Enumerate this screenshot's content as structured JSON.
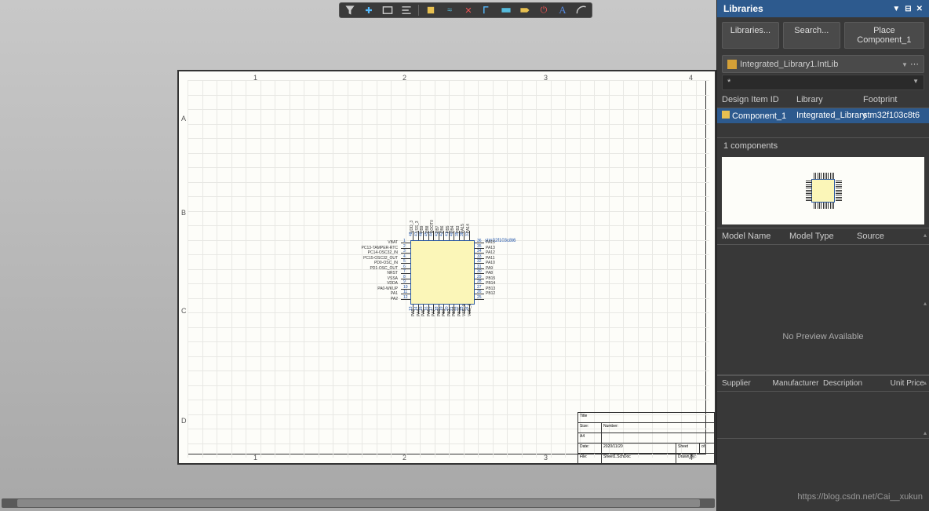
{
  "toolbar": {
    "items": [
      "filter",
      "place-wire",
      "place-rect",
      "align",
      "comp",
      "net",
      "cross",
      "bus",
      "dim",
      "tag",
      "power",
      "text",
      "arc"
    ]
  },
  "sheet": {
    "cols": [
      "1",
      "2",
      "3",
      "4"
    ],
    "rows": [
      "A",
      "B",
      "C",
      "D"
    ],
    "title_block": {
      "title_lbl": "Title",
      "size_lbl": "Size:",
      "size_val": "A4",
      "number_lbl": "Number:",
      "date_lbl": "Date:",
      "date_val": "2020/11/20",
      "file_lbl": "File:",
      "file_val": "Sheet1.SchDoc",
      "sheet_lbl": "Sheet",
      "of_lbl": "of",
      "drawn_lbl": "Drawn By:"
    }
  },
  "component": {
    "designator": "stm32f103c8t6",
    "left_pins": [
      "VBAT",
      "PC13-TAMPER-RTC",
      "PC14-OSC32_IN",
      "PC15-OSC32_OUT",
      "PD0-OSC_IN",
      "PD1-OSC_OUT",
      "NRST",
      "VSSA",
      "VDDA",
      "PA0-WKUP",
      "PA1",
      "PA2"
    ],
    "left_nums": [
      "1",
      "2",
      "3",
      "4",
      "5",
      "6",
      "7",
      "8",
      "9",
      "10",
      "11",
      "12"
    ],
    "right_pins": [
      "VDD_3",
      "VSS_3",
      "PB9",
      "PB8",
      "BOOT0",
      "PB7",
      "PB6",
      "PB5",
      "PB4",
      "PB3",
      "PA15",
      "PA14",
      "PA13",
      "PA12",
      "PA11",
      "PA10",
      "PA9",
      "PA8",
      "PB15",
      "PB14",
      "PB13",
      "PB12"
    ],
    "right_inner": [
      "PA15",
      "PA13",
      "PA12",
      "PA11",
      "PA10",
      "PA9",
      "PA8",
      "PB15",
      "PB14",
      "PB13",
      "PB12"
    ],
    "right_nums": [
      "36",
      "35",
      "34",
      "33",
      "32",
      "31",
      "30",
      "29",
      "28",
      "27",
      "26",
      "25"
    ],
    "top_nums": [
      "48",
      "47",
      "46",
      "45",
      "44",
      "43",
      "42",
      "41",
      "40",
      "39",
      "38",
      "37"
    ],
    "bottom_nums": [
      "13",
      "14",
      "15",
      "16",
      "17",
      "18",
      "19",
      "20",
      "21",
      "22",
      "23",
      "24"
    ],
    "top_pins": [
      "VDD_3",
      "VSS_3",
      "PB9",
      "PB8",
      "BOOT0",
      "PB7",
      "PB6",
      "PB5",
      "PB4",
      "PB3",
      "PA15",
      "PA14"
    ],
    "bottom_pins": [
      "PA3",
      "PA4",
      "PA5",
      "PA6",
      "PA7",
      "PB0",
      "PB1",
      "PB2",
      "PB10",
      "PB11",
      "VSS_1",
      "VDD_1"
    ]
  },
  "libraries": {
    "title": "Libraries",
    "btn_lib": "Libraries...",
    "btn_search": "Search...",
    "btn_place": "Place Component_1",
    "selected_lib": "Integrated_Library1.IntLib",
    "filter": "*",
    "cols": {
      "id": "Design Item ID",
      "lib": "Library",
      "fp": "Footprint"
    },
    "row": {
      "id": "Component_1",
      "lib": "Integrated_Library",
      "fp": "stm32f103c8t6"
    },
    "count": "1 components",
    "model_cols": {
      "name": "Model Name",
      "type": "Model Type",
      "src": "Source"
    },
    "no_preview": "No Preview Available",
    "sup_cols": {
      "sup": "Supplier",
      "man": "Manufacturer",
      "desc": "Description",
      "price": "Unit Price"
    }
  },
  "watermark": "https://blog.csdn.net/Cai__xukun"
}
